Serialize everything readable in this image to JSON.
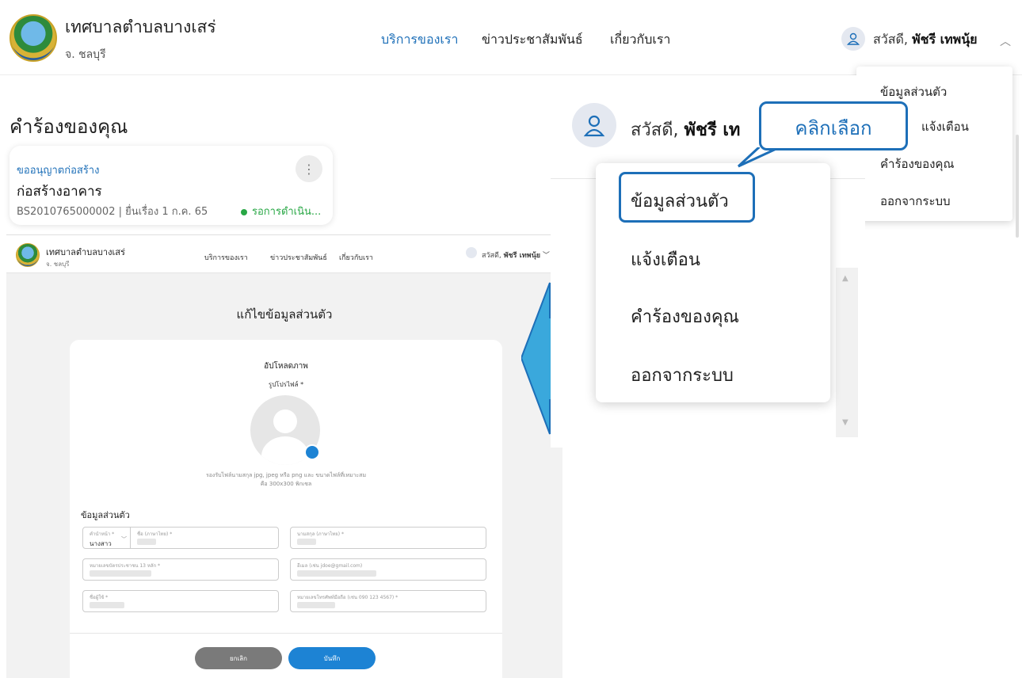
{
  "header": {
    "brand_title": "เทศบาลตำบลบางเสร่",
    "brand_subtitle": "จ. ชลบุรี",
    "nav": [
      "บริการของเรา",
      "ข่าวประชาสัมพันธ์",
      "เกี่ยวกับเรา"
    ],
    "greeting": "สวัสดี,",
    "user_name": "พัชรี เทพนุ้ย"
  },
  "top_menu": [
    "ข้อมูลส่วนตัว",
    "แจ้งเตือน",
    "คำร้องของคุณ",
    "ออกจากระบบ"
  ],
  "requests": {
    "title": "คำร้องของคุณ",
    "card": {
      "type": "ขออนุญาตก่อสร้าง",
      "name": "ก่อสร้างอาคาร",
      "meta": "BS2010765000002 | ยื่นเรื่อง 1 ก.ค. 65",
      "status": "รอการดำเนิน..."
    }
  },
  "embed": {
    "brand_title": "เทศบาลตำบลบางเสร่",
    "brand_subtitle": "จ. ชลบุรี",
    "nav": [
      "บริการของเรา",
      "ข่าวประชาสัมพันธ์",
      "เกี่ยวกับเรา"
    ],
    "greeting": "สวัสดี,",
    "user_name": "พัชรี เทพนุ้ย",
    "title": "แก้ไขข้อมูลส่วนตัว",
    "upload_title": "อัปโหลดภาพ",
    "picture_label": "รูปโปรไฟล์ *",
    "hint": "รองรับไฟล์นามสกุล jpg, jpeg หรือ png และ ขนาดไฟล์ที่เหมาะสมคือ 300x300 พิกเซล",
    "section": "ข้อมูลส่วนตัว",
    "fields": {
      "prefix_label": "คำนำหน้า *",
      "prefix_value": "นางสาว",
      "firstname_label": "ชื่อ (ภาษาไทย) *",
      "lastname_label": "นามสกุล (ภาษาไทย) *",
      "idcard_label": "หมายเลขบัตรประชาชน 13 หลัก *",
      "email_label": "อีเมล (เช่น jdoe@gmail.com)",
      "username_label": "ชื่อผู้ใช้ *",
      "phone_label": "หมายเลขโทรศัพท์มือถือ (เช่น 090 123 4567) *"
    },
    "cancel": "ยกเลิก",
    "save": "บันทึก"
  },
  "zoom": {
    "greeting": "สวัสดี,",
    "user_name": "พัชรี เท",
    "menu": [
      "ข้อมูลส่วนตัว",
      "แจ้งเตือน",
      "คำร้องของคุณ",
      "ออกจากระบบ"
    ]
  },
  "callout": "คลิกเลือก",
  "colors": {
    "accent": "#1d6fb8",
    "arrow": "#3aa8dc",
    "status": "#28a745"
  }
}
